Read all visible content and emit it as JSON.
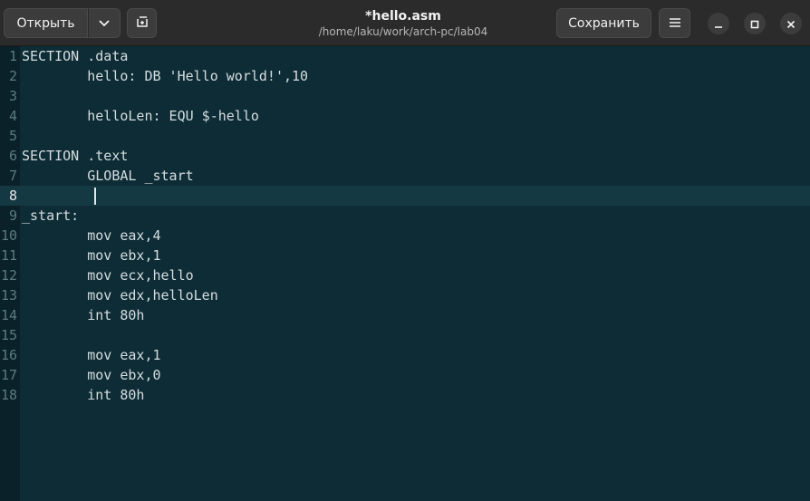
{
  "header": {
    "open_label": "Открыть",
    "title": "*hello.asm",
    "path": "/home/laku/work/arch-pc/lab04",
    "save_label": "Сохранить",
    "icons": {
      "open_menu": "chevron-down-icon",
      "new_tab": "new-tab-icon",
      "menu": "hamburger-menu-icon",
      "minimize": "minimize-icon",
      "maximize": "maximize-icon",
      "close": "close-icon"
    }
  },
  "editor": {
    "current_line": 8,
    "lines": [
      {
        "n": "1",
        "text": "SECTION .data"
      },
      {
        "n": "2",
        "text": "        hello: DB 'Hello world!',10"
      },
      {
        "n": "3",
        "text": ""
      },
      {
        "n": "4",
        "text": "        helloLen: EQU $-hello"
      },
      {
        "n": "5",
        "text": ""
      },
      {
        "n": "6",
        "text": "SECTION .text"
      },
      {
        "n": "7",
        "text": "        GLOBAL _start"
      },
      {
        "n": "8",
        "text": "        "
      },
      {
        "n": "9",
        "text": "_start:"
      },
      {
        "n": "10",
        "text": "        mov eax,4"
      },
      {
        "n": "11",
        "text": "        mov ebx,1"
      },
      {
        "n": "12",
        "text": "        mov ecx,hello"
      },
      {
        "n": "13",
        "text": "        mov edx,helloLen"
      },
      {
        "n": "14",
        "text": "        int 80h"
      },
      {
        "n": "15",
        "text": ""
      },
      {
        "n": "16",
        "text": "        mov eax,1"
      },
      {
        "n": "17",
        "text": "        mov ebx,0"
      },
      {
        "n": "18",
        "text": "        int 80h"
      }
    ]
  },
  "colors": {
    "editor_bg": "#0d2c35",
    "current_line_bg": "#143943",
    "header_bg": "#2b2b2b"
  }
}
